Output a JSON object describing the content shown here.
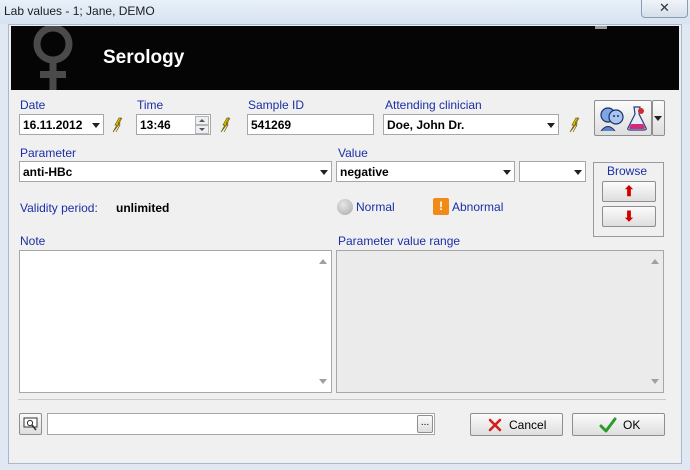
{
  "window": {
    "title": "Lab values - 1; Jane, DEMO",
    "close_glyph": "✕"
  },
  "header": {
    "title": "Serology",
    "icon": "female-symbol-icon"
  },
  "date": {
    "label": "Date",
    "value": "16.11.2012"
  },
  "time": {
    "label": "Time",
    "value": "13:46"
  },
  "sample": {
    "label": "Sample ID",
    "value": "541269"
  },
  "clinician": {
    "label": "Attending clinician",
    "value": "Doe, John Dr."
  },
  "parameter": {
    "label": "Parameter",
    "value": "anti-HBc"
  },
  "value": {
    "label": "Value",
    "selected": "negative",
    "unit": ""
  },
  "browse": {
    "label": "Browse",
    "up_glyph": "⬆",
    "down_glyph": "⬇"
  },
  "validity": {
    "label": "Validity period:",
    "value": "unlimited"
  },
  "status": {
    "normal_label": "Normal",
    "abnormal_label": "Abnormal",
    "abnormal_glyph": "!"
  },
  "note": {
    "label": "Note",
    "value": ""
  },
  "range": {
    "label": "Parameter value range",
    "value": ""
  },
  "footer": {
    "input_value": "",
    "ellipsis": "...",
    "cancel_label": "Cancel",
    "ok_label": "OK"
  },
  "colors": {
    "label_blue": "#1a2fa6",
    "banner": "#050505",
    "abnormal": "#f08a18",
    "ok_green": "#2e9a2e",
    "cancel_red": "#d21f1f"
  }
}
